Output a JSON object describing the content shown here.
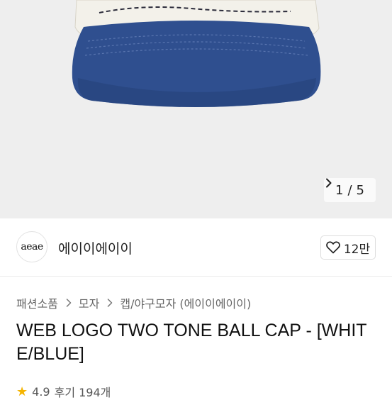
{
  "gallery": {
    "current_page": "1",
    "total_pages": "5",
    "separator": "/",
    "next_icon": "chevron-right-icon"
  },
  "brand": {
    "logo_text": "aeae",
    "name": "에이이에이이",
    "like_icon": "heart-outline-icon",
    "like_count": "12만"
  },
  "breadcrumb": {
    "items": [
      "패션소품",
      "모자",
      "캡/야구모자 (에이이에이이)"
    ]
  },
  "product": {
    "title": "WEB LOGO TWO TONE BALL CAP - [WHITE/BLUE]"
  },
  "rating": {
    "star_icon": "star-icon",
    "score": "4.9",
    "review_text": "후기 194개"
  },
  "colors": {
    "hero_background": "#eeeeee",
    "cap_brim": "#2f4f8f",
    "cap_crown": "#f3f1ea",
    "star": "#f5b400"
  }
}
